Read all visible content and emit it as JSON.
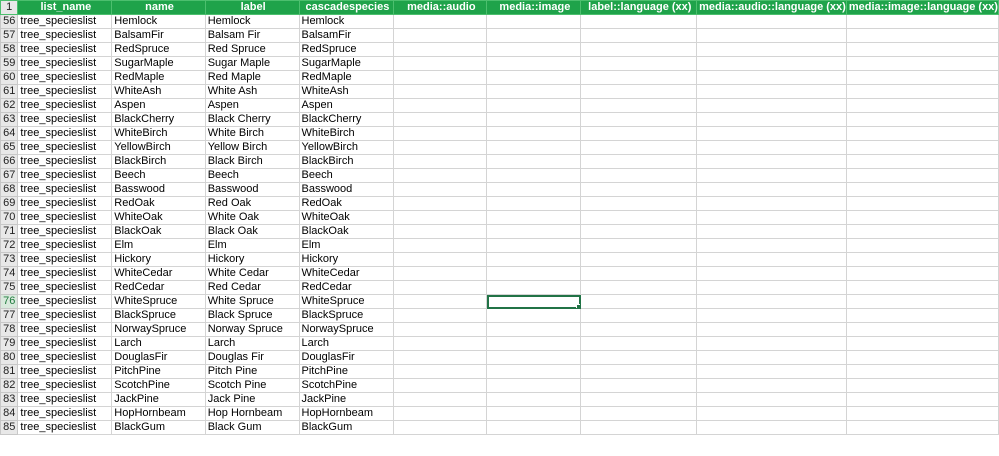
{
  "header_row_number": "1",
  "columns": [
    "list_name",
    "name",
    "label",
    "cascadespecies",
    "media::audio",
    "media::image",
    "label::language (xx)",
    "media::audio::language (xx)",
    "media::image::language (xx)"
  ],
  "rows": [
    {
      "num": "56",
      "cells": [
        "tree_specieslist",
        "Hemlock",
        "Hemlock",
        "Hemlock"
      ]
    },
    {
      "num": "57",
      "cells": [
        "tree_specieslist",
        "BalsamFir",
        "Balsam Fir",
        "BalsamFir"
      ]
    },
    {
      "num": "58",
      "cells": [
        "tree_specieslist",
        "RedSpruce",
        "Red Spruce",
        "RedSpruce"
      ]
    },
    {
      "num": "59",
      "cells": [
        "tree_specieslist",
        "SugarMaple",
        "Sugar Maple",
        "SugarMaple"
      ]
    },
    {
      "num": "60",
      "cells": [
        "tree_specieslist",
        "RedMaple",
        "Red Maple",
        "RedMaple"
      ]
    },
    {
      "num": "61",
      "cells": [
        "tree_specieslist",
        "WhiteAsh",
        "White Ash",
        "WhiteAsh"
      ]
    },
    {
      "num": "62",
      "cells": [
        "tree_specieslist",
        "Aspen",
        "Aspen",
        "Aspen"
      ]
    },
    {
      "num": "63",
      "cells": [
        "tree_specieslist",
        "BlackCherry",
        "Black Cherry",
        "BlackCherry"
      ]
    },
    {
      "num": "64",
      "cells": [
        "tree_specieslist",
        "WhiteBirch",
        "White Birch",
        "WhiteBirch"
      ]
    },
    {
      "num": "65",
      "cells": [
        "tree_specieslist",
        "YellowBirch",
        "Yellow Birch",
        "YellowBirch"
      ]
    },
    {
      "num": "66",
      "cells": [
        "tree_specieslist",
        "BlackBirch",
        "Black Birch",
        "BlackBirch"
      ]
    },
    {
      "num": "67",
      "cells": [
        "tree_specieslist",
        "Beech",
        "Beech",
        "Beech"
      ]
    },
    {
      "num": "68",
      "cells": [
        "tree_specieslist",
        "Basswood",
        "Basswood",
        "Basswood"
      ]
    },
    {
      "num": "69",
      "cells": [
        "tree_specieslist",
        "RedOak",
        "Red Oak",
        "RedOak"
      ]
    },
    {
      "num": "70",
      "cells": [
        "tree_specieslist",
        "WhiteOak",
        "White Oak",
        "WhiteOak"
      ]
    },
    {
      "num": "71",
      "cells": [
        "tree_specieslist",
        "BlackOak",
        "Black Oak",
        "BlackOak"
      ]
    },
    {
      "num": "72",
      "cells": [
        "tree_specieslist",
        "Elm",
        "Elm",
        "Elm"
      ]
    },
    {
      "num": "73",
      "cells": [
        "tree_specieslist",
        "Hickory",
        "Hickory",
        "Hickory"
      ]
    },
    {
      "num": "74",
      "cells": [
        "tree_specieslist",
        "WhiteCedar",
        "White Cedar",
        "WhiteCedar"
      ]
    },
    {
      "num": "75",
      "cells": [
        "tree_specieslist",
        "RedCedar",
        "Red Cedar",
        "RedCedar"
      ]
    },
    {
      "num": "76",
      "cells": [
        "tree_specieslist",
        "WhiteSpruce",
        "White Spruce",
        "WhiteSpruce"
      ]
    },
    {
      "num": "77",
      "cells": [
        "tree_specieslist",
        "BlackSpruce",
        "Black Spruce",
        "BlackSpruce"
      ]
    },
    {
      "num": "78",
      "cells": [
        "tree_specieslist",
        "NorwaySpruce",
        "Norway Spruce",
        "NorwaySpruce"
      ]
    },
    {
      "num": "79",
      "cells": [
        "tree_specieslist",
        "Larch",
        "Larch",
        "Larch"
      ]
    },
    {
      "num": "80",
      "cells": [
        "tree_specieslist",
        "DouglasFir",
        "Douglas Fir",
        "DouglasFir"
      ]
    },
    {
      "num": "81",
      "cells": [
        "tree_specieslist",
        "PitchPine",
        "Pitch Pine",
        "PitchPine"
      ]
    },
    {
      "num": "82",
      "cells": [
        "tree_specieslist",
        "ScotchPine",
        "Scotch Pine",
        "ScotchPine"
      ]
    },
    {
      "num": "83",
      "cells": [
        "tree_specieslist",
        "JackPine",
        "Jack Pine",
        "JackPine"
      ]
    },
    {
      "num": "84",
      "cells": [
        "tree_specieslist",
        "HopHornbeam",
        "Hop Hornbeam",
        "HopHornbeam"
      ]
    },
    {
      "num": "85",
      "cells": [
        "tree_specieslist",
        "BlackGum",
        "Black Gum",
        "BlackGum"
      ]
    }
  ],
  "active_cell": {
    "row": "76",
    "column": "media::image"
  },
  "colors": {
    "header_bg": "#1fa34a",
    "selection": "#217346",
    "gridline": "#d4d4d4"
  }
}
